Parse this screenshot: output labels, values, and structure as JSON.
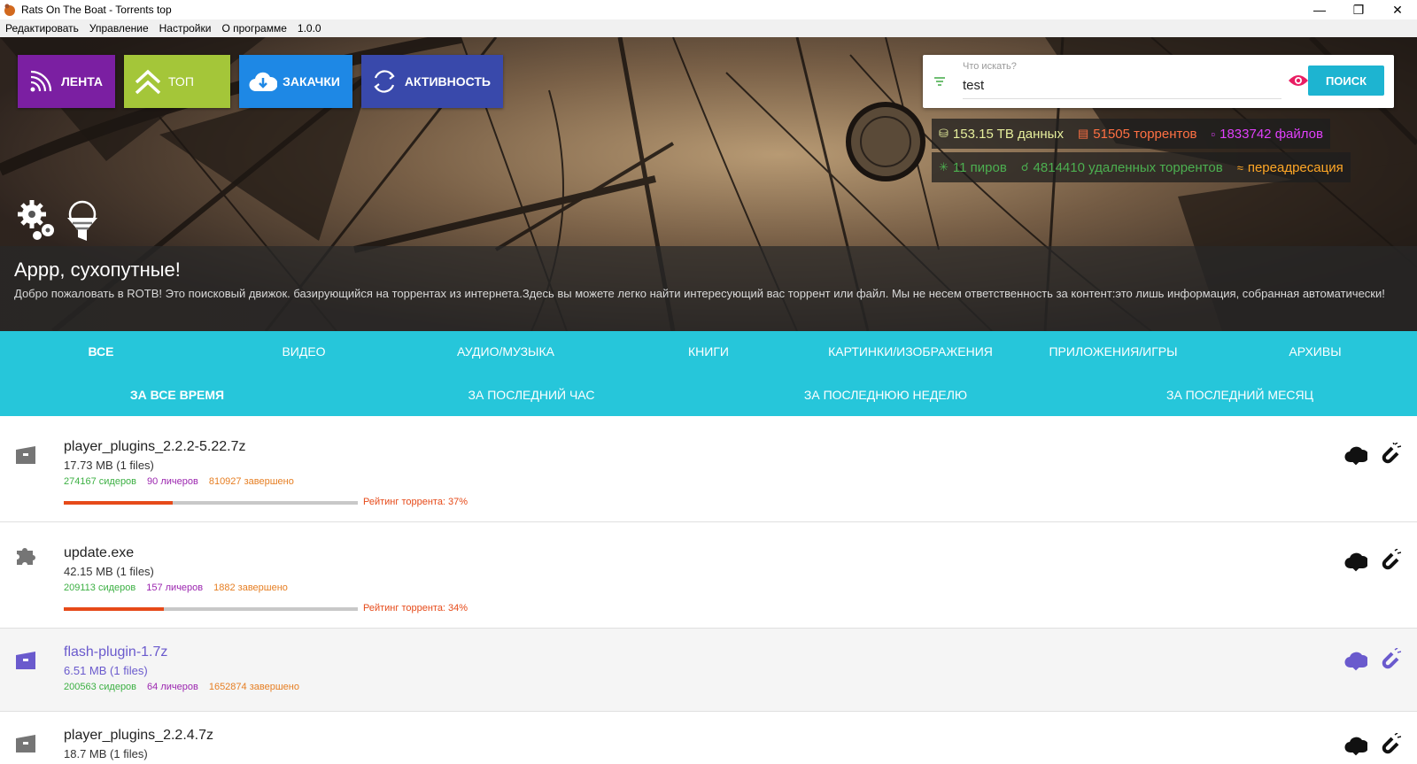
{
  "window": {
    "title": "Rats On The Boat - Torrents top"
  },
  "menu": {
    "items": [
      "Редактировать",
      "Управление",
      "Настройки",
      "О программе",
      "1.0.0"
    ]
  },
  "nav": {
    "feed": "ЛЕНТА",
    "top": "ТОП",
    "downloads": "ЗАКАЧКИ",
    "activity": "АКТИВНОСТЬ"
  },
  "search": {
    "hint": "Что искать?",
    "value": "test",
    "button": "ПОИСК"
  },
  "stats": {
    "data": "153.15 TB данных",
    "torrents": "51505 торрентов",
    "files": "1833742 файлов",
    "peers": "11 пиров",
    "remote": "4814410 удаленных торрентов",
    "redirect": "переадресация"
  },
  "welcome": {
    "title": "Аррр, сухопутные!",
    "text": "Добро пожаловать в ROTB! Это поисковый движок. базирующийся на торрентах из интернета.Здесь вы можете легко найти интересующий вас торрент или файл. Мы не несем ответственность за контент:это лишь информация, собранная автоматически!"
  },
  "categories": [
    "ВСЕ",
    "ВИДЕО",
    "АУДИО/МУЗЫКА",
    "КНИГИ",
    "КАРТИНКИ/ИЗОБРАЖЕНИЯ",
    "ПРИЛОЖЕНИЯ/ИГРЫ",
    "АРХИВЫ"
  ],
  "periods": [
    "ЗА ВСЕ ВРЕМЯ",
    "ЗА ПОСЛЕДНИЙ ЧАС",
    "ЗА ПОСЛЕДНЮЮ НЕДЕЛЮ",
    "ЗА ПОСЛЕДНИЙ МЕСЯЦ"
  ],
  "torrents": [
    {
      "name": "player_plugins_2.2.2-5.22.7z",
      "size": "17.73 MB (1 files)",
      "seeders": "274167 сидеров",
      "leechers": "90 личеров",
      "completed": "810927 завершено",
      "rating_text": "Рейтинг торрента: 37%",
      "rating": 0.37,
      "icon": "archive-icon"
    },
    {
      "name": "update.exe",
      "size": "42.15 MB (1 files)",
      "seeders": "209113 сидеров",
      "leechers": "157 личеров",
      "completed": "1882 завершено",
      "rating_text": "Рейтинг торрента: 34%",
      "rating": 0.34,
      "icon": "puzzle-icon"
    },
    {
      "name": "flash-plugin-1.7z",
      "size": "6.51 MB (1 files)",
      "seeders": "200563 сидеров",
      "leechers": "64 личеров",
      "completed": "1652874 завершено",
      "icon": "archive-icon"
    },
    {
      "name": "player_plugins_2.2.4.7z",
      "size": "18.7 MB (1 files)",
      "icon": "archive-icon"
    }
  ],
  "colors": {
    "feed": "#7b1fa2",
    "top": "#a4c639",
    "downloads": "#1e88e5",
    "activity": "#3949ab",
    "category_bar": "#26c6da",
    "search_button": "#1db4d1",
    "rating": "#e64a19"
  }
}
